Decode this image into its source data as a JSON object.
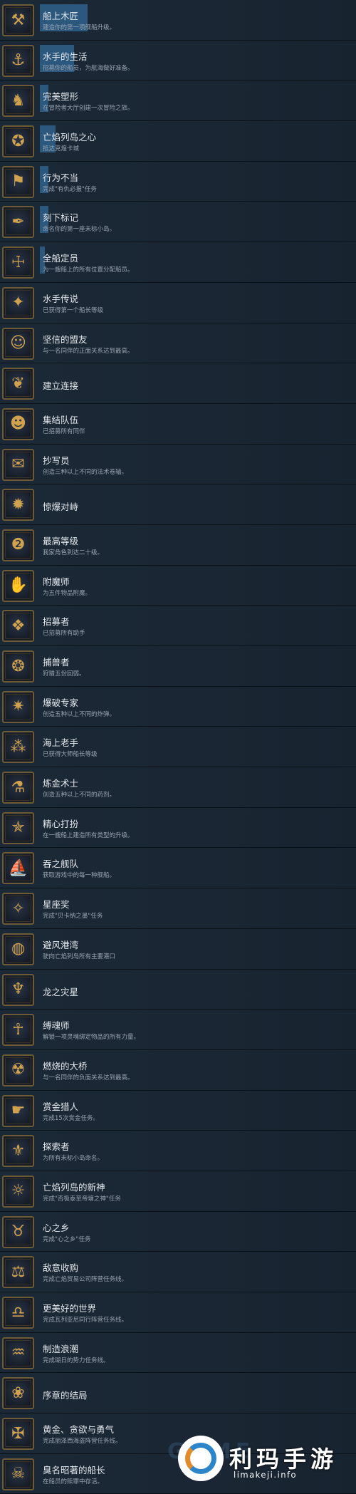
{
  "achievements": [
    {
      "title": "船上木匠",
      "desc": "建造你的第一项舰船升级。",
      "icon": "ship-hammer-icon",
      "glyph": "⚒",
      "progress": 0.28
    },
    {
      "title": "水手的生活",
      "desc": "招募你的船员，为航海做好准备。",
      "icon": "ship-crew-icon",
      "glyph": "⚓",
      "progress": 0.2
    },
    {
      "title": "完美塑形",
      "desc": "在冒险者大厅创建一次冒险之旅。",
      "icon": "figure-shaping-icon",
      "glyph": "♞",
      "progress": 0.05
    },
    {
      "title": "亡焰列岛之心",
      "desc": "抵达克煌卡城",
      "icon": "flame-isles-icon",
      "glyph": "✪",
      "progress": 0.09
    },
    {
      "title": "行为不当",
      "desc": "完成\"有仇必报\"任务",
      "icon": "flag-icon",
      "glyph": "⚑",
      "progress": 0.05
    },
    {
      "title": "刻下标记",
      "desc": "命名你的第一座未标小岛。",
      "icon": "quill-mark-icon",
      "glyph": "✒",
      "progress": 0.05
    },
    {
      "title": "全船定员",
      "desc": "为一艘船上的所有位置分配船员。",
      "icon": "full-crew-icon",
      "glyph": "☩",
      "progress": 0.03
    },
    {
      "title": "水手传说",
      "desc": "已获得第一个船长等级",
      "icon": "sailor-star-icon",
      "glyph": "✦",
      "progress": 0
    },
    {
      "title": "坚信的盟友",
      "desc": "与一名同伴的正面关系达到最高。",
      "icon": "ally-face-icon",
      "glyph": "☺",
      "progress": 0
    },
    {
      "title": "建立连接",
      "desc": "",
      "icon": "connection-hands-icon",
      "glyph": "❦",
      "progress": 0
    },
    {
      "title": "集结队伍",
      "desc": "已招募所有同伴",
      "icon": "party-masks-icon",
      "glyph": "☻",
      "progress": 0
    },
    {
      "title": "抄写员",
      "desc": "创造三种以上不同的法术卷轴。",
      "icon": "scroll-icon",
      "glyph": "✉",
      "progress": 0
    },
    {
      "title": "惊爆对峙",
      "desc": "",
      "icon": "explosion-icon",
      "glyph": "✹",
      "progress": 0
    },
    {
      "title": "最高等级",
      "desc": "我家角色到达二十级。",
      "icon": "level-twenty-icon",
      "glyph": "❷",
      "progress": 0
    },
    {
      "title": "附魔师",
      "desc": "为五件物品附魔。",
      "icon": "enchant-hand-icon",
      "glyph": "✋",
      "progress": 0
    },
    {
      "title": "招募者",
      "desc": "已招募所有助手",
      "icon": "recruit-icon",
      "glyph": "❖",
      "progress": 0
    },
    {
      "title": "捕兽者",
      "desc": "狩猎五份回弱。",
      "icon": "trap-icon",
      "glyph": "❂",
      "progress": 0
    },
    {
      "title": "爆破专家",
      "desc": "创造五种以上不同的炸弹。",
      "icon": "bomb-icon",
      "glyph": "✷",
      "progress": 0
    },
    {
      "title": "海上老手",
      "desc": "已获得大师船长等级",
      "icon": "stars-icon",
      "glyph": "⁂",
      "progress": 0
    },
    {
      "title": "炼金术士",
      "desc": "创造五种以上不同的药剂。",
      "icon": "potion-icon",
      "glyph": "⚗",
      "progress": 0
    },
    {
      "title": "精心打扮",
      "desc": "在一艘船上建造所有类型的升级。",
      "icon": "star-badge-icon",
      "glyph": "✯",
      "progress": 0
    },
    {
      "title": "吞之舰队",
      "desc": "获取游戏中的每一种舰船。",
      "icon": "fleet-icon",
      "glyph": "⛵",
      "progress": 0
    },
    {
      "title": "星座奖",
      "desc": "完成\"贝卡纳之墨\"任务",
      "icon": "constellation-icon",
      "glyph": "✧",
      "progress": 0
    },
    {
      "title": "避风港湾",
      "desc": "驶向亡焰列岛所有主要港口",
      "icon": "globe-icon",
      "glyph": "◍",
      "progress": 0
    },
    {
      "title": "龙之灾星",
      "desc": "",
      "icon": "dragon-icon",
      "glyph": "♆",
      "progress": 0
    },
    {
      "title": "缚魂师",
      "desc": "解锁一项灵魂绑定物品的所有力量。",
      "icon": "soulbind-icon",
      "glyph": "☥",
      "progress": 0
    },
    {
      "title": "燃烧的大桥",
      "desc": "与一名同伴的负面关系达到最高。",
      "icon": "burning-bridge-icon",
      "glyph": "☢",
      "progress": 0
    },
    {
      "title": "赏金猎人",
      "desc": "完成15次赏金任务。",
      "icon": "bounty-hand-icon",
      "glyph": "☛",
      "progress": 0
    },
    {
      "title": "探索者",
      "desc": "为所有未标小岛命名。",
      "icon": "explorer-icon",
      "glyph": "⚜",
      "progress": 0
    },
    {
      "title": "亡焰列岛的新神",
      "desc": "完成\"否极泰至帝塘之神\"任务",
      "icon": "new-god-icon",
      "glyph": "☼",
      "progress": 0
    },
    {
      "title": "心之乡",
      "desc": "完成\"心之乡\"任务",
      "icon": "horned-skull-icon",
      "glyph": "♉",
      "progress": 0
    },
    {
      "title": "敌意收购",
      "desc": "完成亡焰贸易公司阵营任务线。",
      "icon": "takeover-icon",
      "glyph": "⚖",
      "progress": 0
    },
    {
      "title": "更美好的世界",
      "desc": "完成瓦列亚尼同行阵营任务线。",
      "icon": "scales-icon",
      "glyph": "♎",
      "progress": 0
    },
    {
      "title": "制造浪潮",
      "desc": "完成瑚日的势力任务线。",
      "icon": "wave-icon",
      "glyph": "♒",
      "progress": 0
    },
    {
      "title": "序章的结局",
      "desc": "",
      "icon": "prologue-end-icon",
      "glyph": "❀",
      "progress": 0
    },
    {
      "title": "黄金、贪欲与勇气",
      "desc": "完成丽泽西海盗阵营任务线。",
      "icon": "pirate-gold-icon",
      "glyph": "✠",
      "progress": 0
    },
    {
      "title": "臭名昭著的船长",
      "desc": "在船员的赎罪中存活。",
      "icon": "notorious-captain-icon",
      "glyph": "☠",
      "progress": 0
    }
  ],
  "watermark": {
    "text": "GAME",
    "logo_cn": "利玛手游",
    "logo_en": "limakeji.info"
  }
}
